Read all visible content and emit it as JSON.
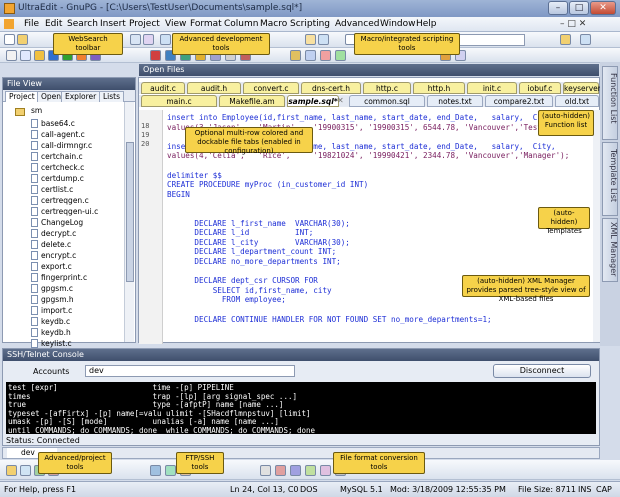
{
  "window": {
    "title": "UltraEdit - GnuPG - [C:\\Users\\TestUser\\Documents\\sample.sql*]"
  },
  "menu": [
    "File",
    "Edit",
    "Search",
    "Insert",
    "Project",
    "View",
    "Format",
    "Column",
    "Macro",
    "Scripting",
    "Advanced",
    "Window",
    "Help"
  ],
  "search_box": {
    "value": "\\n +"
  },
  "callouts": {
    "websearch": "WebSearch toolbar",
    "advdev": "Advanced development tools",
    "macro": "Macro/integrated scripting tools",
    "tabs": "Optional multi-row colored and dockable file tabs (enabled in configuration)",
    "function_list": "(auto-hidden) Function list",
    "templates": "(auto-hidden) Templates",
    "xml": "(auto-hidden) XML Manager provides parsed tree-style view of XML-based files",
    "advproj": "Advanced/project tools",
    "ftp": "FTP/SSH tools",
    "fileconv": "File format conversion tools"
  },
  "file_view": {
    "title": "File View",
    "tabs": [
      "Project",
      "Open",
      "Explorer",
      "Lists"
    ],
    "folder": "sm",
    "files": [
      "base64.c",
      "call-agent.c",
      "call-dirmngr.c",
      "certchain.c",
      "certcheck.c",
      "certdump.c",
      "certlist.c",
      "certreqgen.c",
      "certreqgen-ui.c",
      "ChangeLog",
      "decrypt.c",
      "delete.c",
      "encrypt.c",
      "export.c",
      "fingerprint.c",
      "gpgsm.c",
      "gpgsm.h",
      "import.c",
      "keydb.c",
      "keydb.h",
      "keylist.c"
    ]
  },
  "open_files": {
    "title": "Open Files",
    "row1": [
      "audit.c",
      "audit.h",
      "convert.c",
      "dns-cert.h",
      "http.c",
      "http.h",
      "init.c",
      "iobuf.c",
      "keyserver.h"
    ],
    "row2": [
      "main.c",
      "Makefile.am",
      "sample.sql*",
      "common.sql",
      "notes.txt",
      "compare2.txt",
      "old.txt"
    ]
  },
  "code": {
    "line_numbers": [
      "18",
      "19",
      "20"
    ],
    "lines": [
      [
        "insert into Employee(id,first_name, last_name, start_date, end_Date,   salary,  City,"
      ],
      [
        "values(3,'Jason',   'Martin',   '19900315', '19900315', 6544.78, 'Vancouver','Tester');"
      ],
      [
        ""
      ],
      [
        "insert into Employee(id,first_name, last_name, start_date, end_Date,   salary,  City,"
      ],
      [
        "values(4,'Celia',   'Rice',     '19821024', '19990421', 2344.78, 'Vancouver','Manager');"
      ],
      [
        ""
      ],
      [
        "delimiter $$"
      ],
      [
        "CREATE PROCEDURE myProc (in_customer_id INT)"
      ],
      [
        "BEGIN"
      ],
      [
        ""
      ],
      [
        ""
      ],
      [
        "      DECLARE l_first_name  VARCHAR(30);"
      ],
      [
        "      DECLARE l_id          INT;"
      ],
      [
        "      DECLARE l_city        VARCHAR(30);"
      ],
      [
        "      DECLARE l_department_count INT;"
      ],
      [
        "      DECLARE no_more_departments INT;"
      ],
      [
        ""
      ],
      [
        "      DECLARE dept_csr CURSOR FOR"
      ],
      [
        "          SELECT id,first_name, city"
      ],
      [
        "            FROM employee;"
      ],
      [
        ""
      ],
      [
        "      DECLARE CONTINUE HANDLER FOR NOT FOUND SET no_more_departments=1;"
      ]
    ]
  },
  "right_tabs": [
    "Function List",
    "Template List",
    "XML Manager"
  ],
  "ssh": {
    "title": "SSH/Telnet Console",
    "accounts_label": "Accounts",
    "accounts_value": "dev",
    "disconnect": "Disconnect",
    "console": [
      "test [expr]                     time -[p] PIPELINE",
      "times                           trap -[lp] [arg signal_spec ...]",
      "true                            type -[afptP] name [name ...]",
      "typeset -[afFirtx] -[p] name[=valu ulimit -[SHacdflmnpstuv] [limit]",
      "umask -[p] -[S] [mode]          unalias [-a] name [name ...]",
      "until COMMANDS; do COMMANDS; done  while COMMANDS; do COMMANDS; done"
    ],
    "status": "Status: Connected"
  },
  "bottom_tab": "dev",
  "status_bar": {
    "help": "For Help, press F1",
    "position": "Ln 24, Col 13, C0",
    "format": "DOS",
    "language": "MySQL 5.1",
    "modified": "Mod: 3/18/2009 12:55:35 PM",
    "size": "File Size: 8711",
    "ins": "INS",
    "cap": "CAP"
  },
  "colors": {
    "accent": "#f6d24a",
    "title": "#7f98c4",
    "pane_header": "#3f4f6c"
  }
}
